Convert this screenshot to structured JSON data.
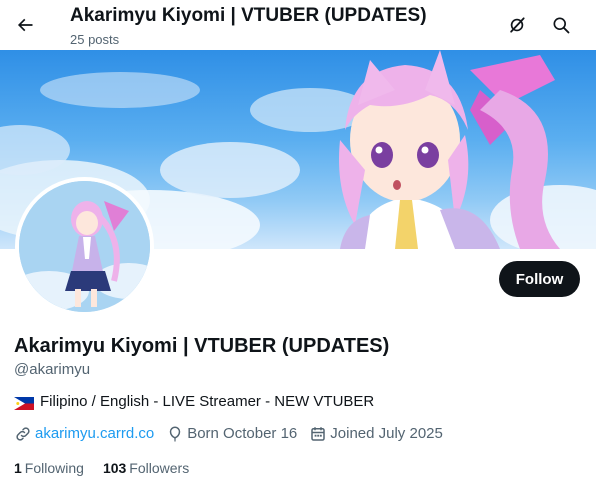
{
  "header": {
    "title": "Akarimyu Kiyomi | VTUBER (UPDATES)",
    "post_count": "25 posts"
  },
  "icons": {
    "back": "arrow-left-icon",
    "grok": "grok-icon",
    "search": "search-icon",
    "link": "link-icon",
    "birthday": "balloon-icon",
    "joined": "calendar-icon"
  },
  "profile": {
    "name": "Akarimyu Kiyomi | VTUBER (UPDATES)",
    "handle": "@akarimyu",
    "follow_label": "Follow",
    "bio_text": "Filipino / English - LIVE Streamer - NEW VTUBER",
    "bio_flag": "Philippines flag",
    "website": "akarimyu.carrd.co",
    "birthday": "Born October 16",
    "joined": "Joined July 2025"
  },
  "stats": {
    "following_count": "1",
    "following_label": "Following",
    "followers_count": "103",
    "followers_label": "Followers"
  },
  "colors": {
    "text": "#0f1419",
    "muted": "#536471",
    "link": "#1d9bf0",
    "button_bg": "#0f1419",
    "button_text": "#ffffff"
  }
}
